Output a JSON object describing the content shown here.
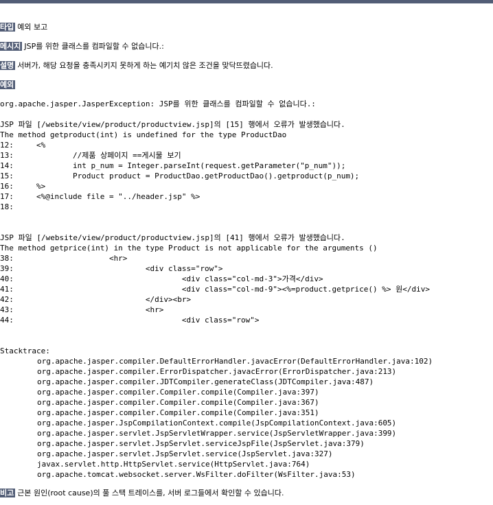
{
  "type": {
    "label": "타입",
    "value": "예외 보고"
  },
  "message": {
    "label": "메시지",
    "value": "JSP를 위한 클래스를 컴파일할 수 없습니다.:"
  },
  "description": {
    "label": "설명",
    "value": "서버가, 해당 요청을 충족시키지 못하게 하는 예기치 않은 조건을 맞닥뜨렸습니다."
  },
  "exception": {
    "label": "예외"
  },
  "exception_header": "org.apache.jasper.JasperException: JSP를 위한 클래스를 컴파일할 수 없습니다.:",
  "error1": {
    "location": "JSP 파일 [/website/view/product/productview.jsp]의 [15] 행에서 오류가 발생했습니다.",
    "message": "The method getproduct(int) is undefined for the type ProductDao",
    "lines": [
      "12:     <%",
      "13:             //제품 상페이지 ==게시물 보기",
      "14:             int p_num = Integer.parseInt(request.getParameter(\"p_num\"));",
      "15:             Product product = ProductDao.getProductDao().getproduct(p_num);",
      "16:     %>",
      "17:     <%@include file = \"../header.jsp\" %>",
      "18:"
    ]
  },
  "error2": {
    "location": "JSP 파일 [/website/view/product/productview.jsp]의 [41] 행에서 오류가 발생했습니다.",
    "message": "The method getprice(int) in the type Product is not applicable for the arguments ()",
    "lines": [
      "38:                     <hr>",
      "39:                             <div class=\"row\">",
      "40:                                     <div class=\"col-md-3\">가격</div>",
      "41:                                     <div class=\"col-md-9\"><%=product.getprice() %> 원</div>",
      "42:                             </div><br>",
      "43:                             <hr>",
      "44:                                     <div class=\"row\">"
    ]
  },
  "stacktrace": {
    "title": "Stacktrace:",
    "frames": [
      "org.apache.jasper.compiler.DefaultErrorHandler.javacError(DefaultErrorHandler.java:102)",
      "org.apache.jasper.compiler.ErrorDispatcher.javacError(ErrorDispatcher.java:213)",
      "org.apache.jasper.compiler.JDTCompiler.generateClass(JDTCompiler.java:487)",
      "org.apache.jasper.compiler.Compiler.compile(Compiler.java:397)",
      "org.apache.jasper.compiler.Compiler.compile(Compiler.java:367)",
      "org.apache.jasper.compiler.Compiler.compile(Compiler.java:351)",
      "org.apache.jasper.JspCompilationContext.compile(JspCompilationContext.java:605)",
      "org.apache.jasper.servlet.JspServletWrapper.service(JspServletWrapper.java:399)",
      "org.apache.jasper.servlet.JspServlet.serviceJspFile(JspServlet.java:379)",
      "org.apache.jasper.servlet.JspServlet.service(JspServlet.java:327)",
      "javax.servlet.http.HttpServlet.service(HttpServlet.java:764)",
      "org.apache.tomcat.websocket.server.WsFilter.doFilter(WsFilter.java:53)"
    ]
  },
  "note": {
    "label": "비고",
    "value": "근본 원인(root cause)의 풀 스택 트레이스를, 서버 로그들에서 확인할 수 있습니다."
  }
}
